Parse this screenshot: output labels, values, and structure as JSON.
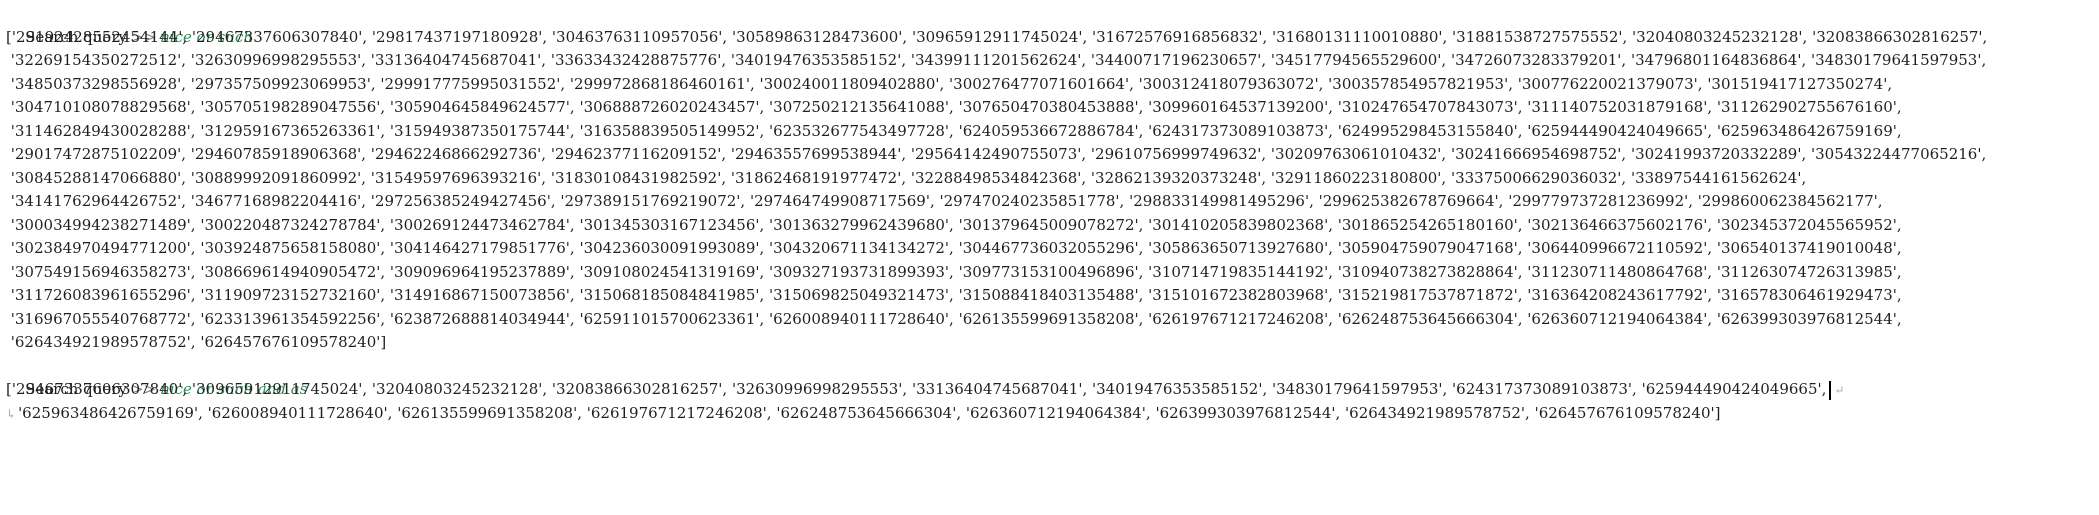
{
  "console": {
    "queries": [
      {
        "prompt_label": "Search query",
        "prompt_arrow": ">>",
        "query": "nice or such",
        "result_lines": [
          "['29192428552454144', '29467337606307840', '29817437197180928', '30463763110957056', '30589863128473600', '30965912911745024', '31672576916856832', '31680131110010880', '31881538727575552', '32040803245232128', '32083866302816257',",
          " '32269154350272512', '32630996998295553', '33136404745687041', '33633432428875776', '34019476353585152', '34399111201562624', '34400717196230657', '34517794565529600', '34726073283379201', '34796801164836864', '34830179641597953',",
          " '34850373298556928', '297357509923069953', '299917775995031552', '299972868186460161', '300240011809402880', '300276477071601664', '300312418079363072', '300357854957821953', '300776220021379073', '301519417127350274',",
          " '304710108078829568', '305705198289047556', '305904645849624577', '306888726020243457', '307250212135641088', '307650470380453888', '309960164537139200', '310247654707843073', '311140752031879168', '311262902755676160',",
          " '311462849430028288', '312959167365263361', '315949387350175744', '316358839505149952', '623532677543497728', '624059536672886784', '624317373089103873', '624995298453155840', '625944490424049665', '625963486426759169',",
          " '29017472875102209', '29460785918906368', '29462246866292736', '29462377116209152', '29463557699538944', '29564142490755073', '29610756999749632', '30209763061010432', '30241666954698752', '30241993720332289', '30543224477065216',",
          " '30845288147066880', '30889992091860992', '31549597696393216', '31830108431982592', '31862468191977472', '32288498534842368', '32862139320373248', '32911860223180800', '33375006629036032', '33897544161562624',",
          " '34141762964426752', '34677168982204416', '297256385249427456', '297389151769219072', '297464749908717569', '297470240235851778', '298833149981495296', '299625382678769664', '299779737281236992', '299860062384562177',",
          " '300034994238271489', '300220487324278784', '300269124473462784', '301345303167123456', '301363279962439680', '301379645009078272', '301410205839802368', '301865254265180160', '302136466375602176', '302345372045565952',",
          " '302384970494771200', '303924875658158080', '304146427179851776', '304236030091993089', '304320671134134272', '304467736032055296', '305863650713927680', '305904759079047168', '306440996672110592', '306540137419010048',",
          " '307549156946358273', '308669614940905472', '309096964195237889', '309108024541319169', '309327193731899393', '309773153100496896', '310714719835144192', '310940738273828864', '311230711480864768', '311263074726313985',",
          " '311726083961655296', '311909723152732160', '314916867150073856', '315068185084841985', '315069825049321473', '315088418403135488', '315101672382803968', '315219817537871872', '316364208243617792', '316578306461929473',",
          " '316967055540768772', '623313961354592256', '623872688814034944', '625911015700623361', '626008940111728640', '626135599691358208', '626197671217246208', '626248753645666304', '626360712194064384', '626399303976812544',",
          " '626434921989578752', '626457676109578240']"
        ]
      },
      {
        "prompt_label": "Search query",
        "prompt_arrow": ">>",
        "query": "nice or such and as",
        "result_lines": [
          "['29467337606307840', '30965912911745024', '32040803245232128', '32083866302816257', '32630996998295553', '33136404745687041', '34019476353585152', '34830179641597953', '624317373089103873', '625944490424049665',",
          "'625963486426759169', '626008940111728640', '626135599691358208', '626197671217246208', '626248753645666304', '626360712194064384', '626399303976812544', '626434921989578752', '626457676109578240']"
        ]
      }
    ]
  }
}
